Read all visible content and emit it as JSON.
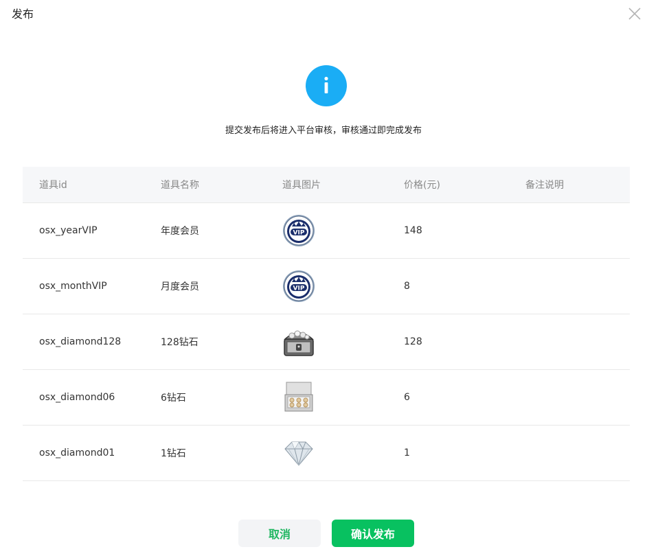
{
  "dialog": {
    "title": "发布",
    "notice": "提交发布后将进入平台审核，审核通过即完成发布",
    "cancel_label": "取消",
    "confirm_label": "确认发布"
  },
  "colors": {
    "info_blue": "#1aadf5",
    "primary_green": "#08c160",
    "header_bg": "#f6f7f9"
  },
  "table": {
    "headers": {
      "id": "道具id",
      "name": "道具名称",
      "image": "道具图片",
      "price": "价格(元)",
      "note": "备注说明"
    },
    "rows": [
      {
        "id": "osx_yearVIP",
        "name": "年度会员",
        "image": "vip-badge-icon",
        "price": "148",
        "note": ""
      },
      {
        "id": "osx_monthVIP",
        "name": "月度会员",
        "image": "vip-badge-icon",
        "price": "8",
        "note": ""
      },
      {
        "id": "osx_diamond128",
        "name": "128钻石",
        "image": "treasure-chest-icon",
        "price": "128",
        "note": ""
      },
      {
        "id": "osx_diamond06",
        "name": "6钻石",
        "image": "diamond-box-icon",
        "price": "6",
        "note": ""
      },
      {
        "id": "osx_diamond01",
        "name": "1钻石",
        "image": "diamond-icon",
        "price": "1",
        "note": ""
      }
    ]
  }
}
